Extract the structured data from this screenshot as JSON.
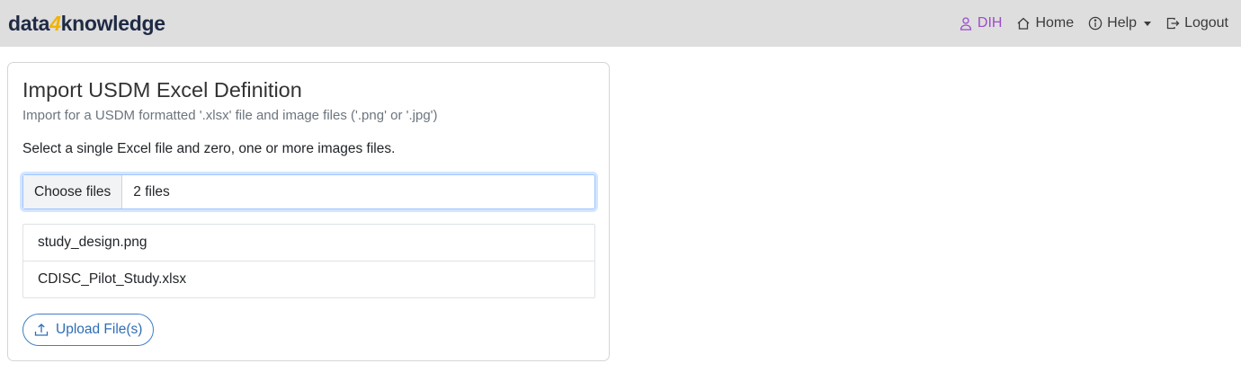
{
  "navbar": {
    "brand_prefix": "data",
    "brand_mid": "4",
    "brand_suffix": "knowledge",
    "user_label": "DIH",
    "home_label": "Home",
    "help_label": "Help",
    "logout_label": "Logout",
    "colors": {
      "background": "#dedede",
      "user": "#9b4dca",
      "brand": "#1f2a44",
      "brand_accent": "#f0b400"
    }
  },
  "card": {
    "title": "Import USDM Excel Definition",
    "subtitle": "Import for a USDM formatted '.xlsx' file and image files ('.png' or '.jpg')",
    "instruction": "Select a single Excel file and zero, one or more images files.",
    "file_input": {
      "button_label": "Choose files",
      "status": "2 files"
    },
    "files": [
      {
        "name": "study_design.png"
      },
      {
        "name": "CDISC_Pilot_Study.xlsx"
      }
    ],
    "upload_label": "Upload File(s)",
    "icons": {
      "upload": "upload-icon"
    }
  }
}
